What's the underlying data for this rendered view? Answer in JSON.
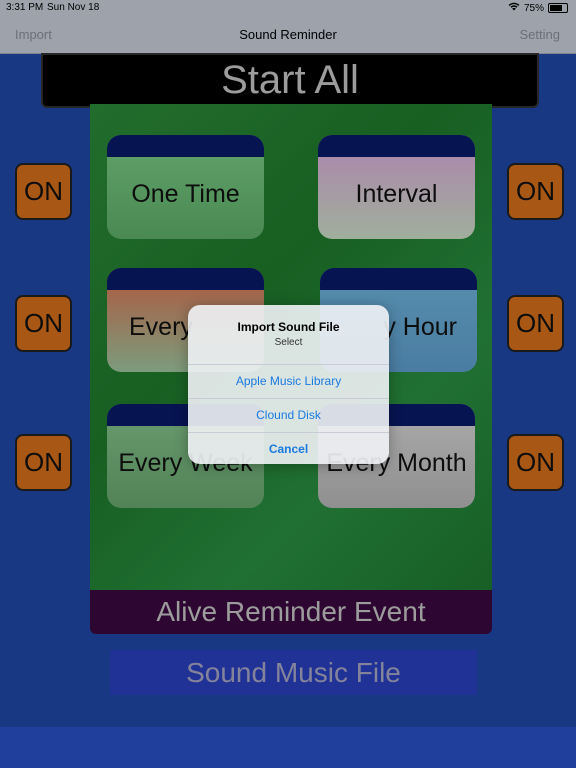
{
  "status_bar": {
    "time": "3:31 PM",
    "date": "Sun Nov 18",
    "battery": "75%"
  },
  "nav": {
    "left": "Import",
    "title": "Sound Reminder",
    "right": "Setting"
  },
  "start_all": "Start All",
  "tiles": [
    {
      "label": "One Time"
    },
    {
      "label": "Interval"
    },
    {
      "label": "Every"
    },
    {
      "label": "y Hour"
    },
    {
      "label": "Every Week"
    },
    {
      "label": "Every Month"
    }
  ],
  "on_buttons": [
    "ON",
    "ON",
    "ON",
    "ON",
    "ON",
    "ON"
  ],
  "alive_reminder": "Alive Reminder Event",
  "sound_music": "Sound Music File",
  "dialog": {
    "title": "Import Sound File",
    "subtitle": "Select",
    "options": [
      "Apple Music Library",
      "Clound Disk"
    ],
    "cancel": "Cancel"
  },
  "colors": {
    "background": "#1f48a8",
    "on_button": "#d8701c",
    "action_text": "#1a7ae0"
  }
}
